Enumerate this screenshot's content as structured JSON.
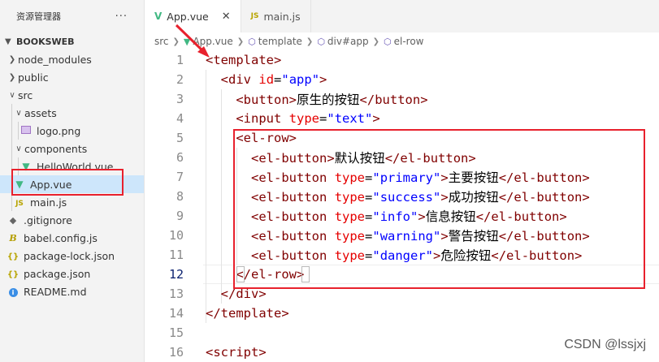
{
  "sidebar": {
    "title": "资源管理器",
    "more": "···",
    "section": "BOOKSWEB",
    "items": [
      {
        "label": "node_modules",
        "type": "folder",
        "icon": "chevron-right-icon"
      },
      {
        "label": "public",
        "type": "folder",
        "icon": "chevron-right-icon"
      },
      {
        "label": "src",
        "type": "folder-open",
        "icon": "chevron-down-icon"
      },
      {
        "label": "assets",
        "type": "folder-open",
        "icon": "chevron-down-icon"
      },
      {
        "label": "logo.png",
        "type": "image",
        "icon": "image-file-icon"
      },
      {
        "label": "components",
        "type": "folder-open",
        "icon": "chevron-down-icon"
      },
      {
        "label": "HelloWorld.vue",
        "type": "vue",
        "icon": "vue-file-icon"
      },
      {
        "label": "App.vue",
        "type": "vue",
        "icon": "vue-file-icon"
      },
      {
        "label": "main.js",
        "type": "js",
        "icon": "js-file-icon",
        "glyph": "JS"
      },
      {
        "label": ".gitignore",
        "type": "git",
        "icon": "git-file-icon"
      },
      {
        "label": "babel.config.js",
        "type": "babel",
        "icon": "babel-file-icon",
        "glyph": "B"
      },
      {
        "label": "package-lock.json",
        "type": "json",
        "icon": "json-file-icon",
        "glyph": "{}"
      },
      {
        "label": "package.json",
        "type": "json",
        "icon": "json-file-icon",
        "glyph": "{}"
      },
      {
        "label": "README.md",
        "type": "info",
        "icon": "info-file-icon",
        "glyph": "i"
      }
    ]
  },
  "tabs": [
    {
      "label": "App.vue",
      "icon": "vue-file-icon",
      "glyph": "V",
      "close": "✕",
      "active": true
    },
    {
      "label": "main.js",
      "icon": "js-file-icon",
      "glyph": "JS",
      "active": false
    }
  ],
  "breadcrumb": [
    "src",
    "App.vue",
    "template",
    "div#app",
    "el-row"
  ],
  "editor": {
    "current_line": 12,
    "lines": [
      {
        "n": "1",
        "text": "<template>"
      },
      {
        "n": "2",
        "text": "  <div id=\"app\">"
      },
      {
        "n": "3",
        "text": "    <button>原生的按钮</button>"
      },
      {
        "n": "4",
        "text": "    <input type=\"text\">"
      },
      {
        "n": "5",
        "text": "    <el-row>"
      },
      {
        "n": "6",
        "text": "      <el-button>默认按钮</el-button>"
      },
      {
        "n": "7",
        "text": "      <el-button type=\"primary\">主要按钮</el-button>"
      },
      {
        "n": "8",
        "text": "      <el-button type=\"success\">成功按钮</el-button>"
      },
      {
        "n": "9",
        "text": "      <el-button type=\"info\">信息按钮</el-button>"
      },
      {
        "n": "10",
        "text": "      <el-button type=\"warning\">警告按钮</el-button>"
      },
      {
        "n": "11",
        "text": "      <el-button type=\"danger\">危险按钮</el-button>"
      },
      {
        "n": "12",
        "text": "    </el-row>"
      },
      {
        "n": "13",
        "text": "  </div>"
      },
      {
        "n": "14",
        "text": "</template>"
      },
      {
        "n": "15",
        "text": ""
      },
      {
        "n": "16",
        "text": "<script>"
      }
    ]
  },
  "watermark": "CSDN @lssjxj",
  "colors": {
    "annotation_red": "#e8212d",
    "vue_green": "#41b883",
    "tag": "#800000",
    "attr": "#e50000",
    "string": "#0000ff"
  }
}
